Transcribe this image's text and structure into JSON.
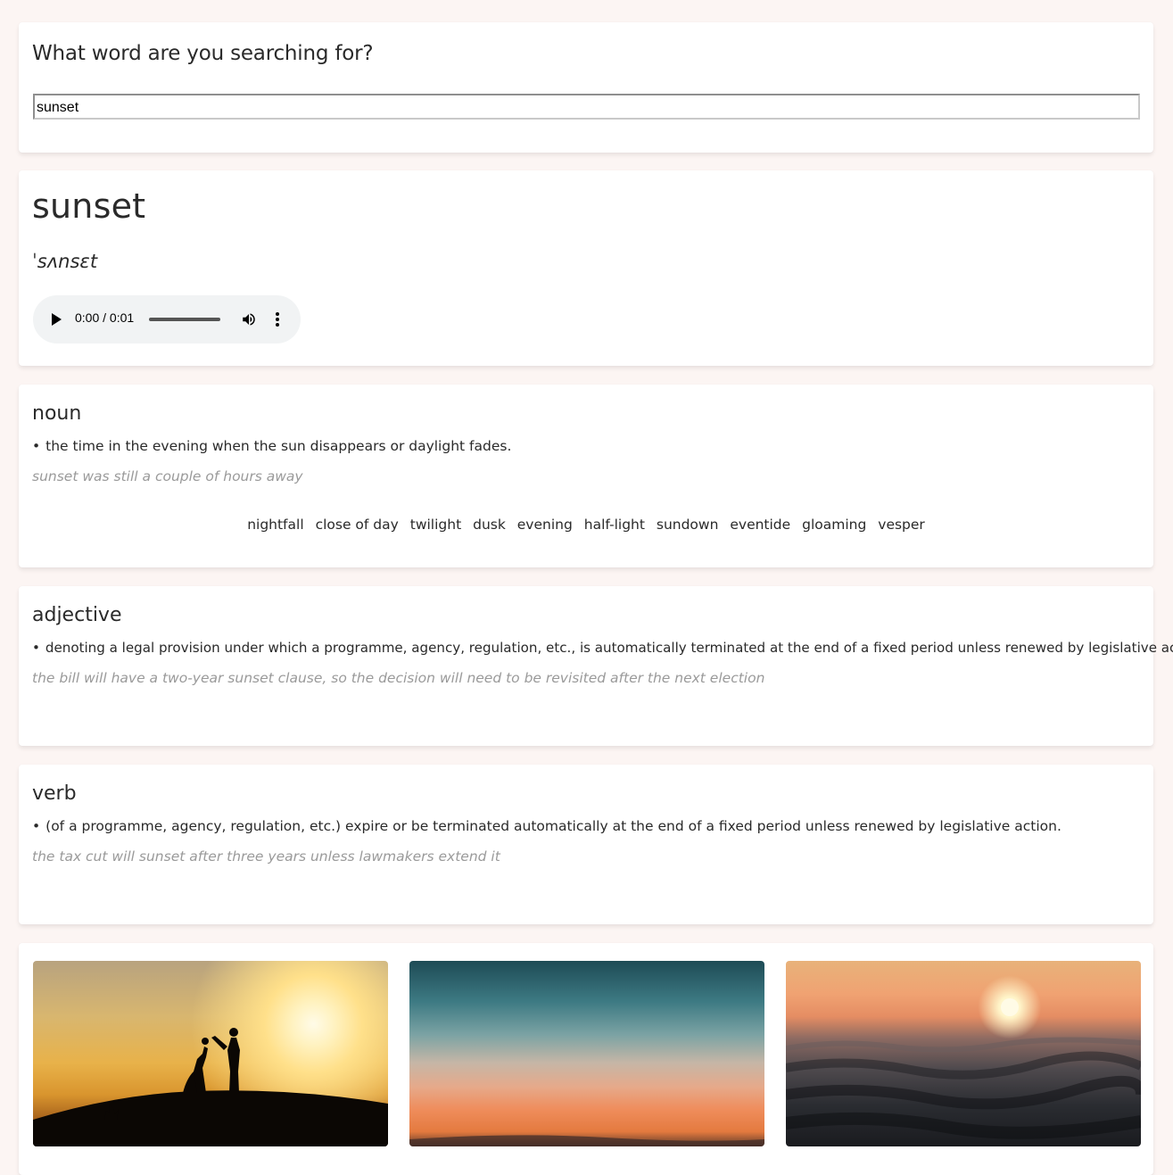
{
  "search": {
    "heading": "What word are you searching for?",
    "value": "sunset"
  },
  "word": {
    "title": "sunset",
    "phonetic": "ˈsʌnsɛt",
    "audio": {
      "time": "0:00 / 0:01",
      "progress": 0
    }
  },
  "meanings": [
    {
      "part_of_speech": "noun",
      "definition": "the time in the evening when the sun disappears or daylight fades.",
      "example": "sunset was still a couple of hours away",
      "synonyms": [
        "nightfall",
        "close of day",
        "twilight",
        "dusk",
        "evening",
        "half-light",
        "sundown",
        "eventide",
        "gloaming",
        "vesper"
      ]
    },
    {
      "part_of_speech": "adjective",
      "definition": "denoting a legal provision under which a programme, agency, regulation, etc., is automatically terminated at the end of a fixed period unless renewed by legislative action.",
      "example": "the bill will have a two-year sunset clause, so the decision will need to be revisited after the next election"
    },
    {
      "part_of_speech": "verb",
      "definition": "(of a programme, agency, regulation, etc.) expire or be terminated automatically at the end of a fixed period unless renewed by legislative action.",
      "example": "the tax cut will sunset after three years unless lawmakers extend it"
    }
  ],
  "bullet": "•",
  "images": [
    {
      "name": "couple-silhouette-sunset-photo"
    },
    {
      "name": "teal-orange-sky-photo"
    },
    {
      "name": "ocean-waves-sunset-photo"
    }
  ],
  "colors": {
    "page_background": "#fcf5f3",
    "card_background": "#ffffff",
    "text": "#2a2a2a",
    "example_text": "#9a9a9a",
    "audio_background": "#f1f3f4"
  }
}
